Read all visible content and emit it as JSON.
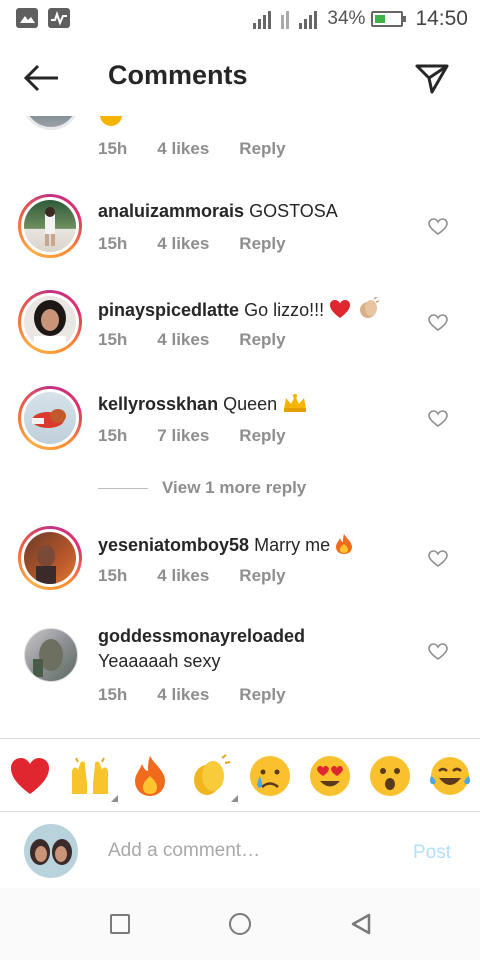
{
  "status_bar": {
    "battery": "34%",
    "time": "14:50"
  },
  "header": {
    "title": "Comments",
    "back_icon": "arrow-left-icon",
    "send_icon": "paper-plane-icon"
  },
  "previous_comment": {
    "time": "15h",
    "likes": "4 likes",
    "reply": "Reply"
  },
  "comments": [
    {
      "username": "analuizammorais",
      "text": "GOSTOSA",
      "time": "15h",
      "likes": "4 likes",
      "reply": "Reply"
    },
    {
      "username": "pinayspicedlatte",
      "text": "Go lizzo!!!",
      "time": "15h",
      "likes": "4 likes",
      "reply": "Reply"
    },
    {
      "username": "kellyrosskhan",
      "text": "Queen",
      "time": "15h",
      "likes": "7 likes",
      "reply": "Reply"
    },
    {
      "username": "yeseniatomboy58",
      "text": "Marry me",
      "time": "15h",
      "likes": "4 likes",
      "reply": "Reply"
    },
    {
      "username": "goddessmonayreloaded",
      "text": "Yeaaaaah sexy",
      "time": "15h",
      "likes": "4 likes",
      "reply": "Reply"
    }
  ],
  "view_more_replies": "View 1 more reply",
  "emoji_bar": [
    "red-heart",
    "raising-hands",
    "fire",
    "clapping-hands",
    "crying-face",
    "heart-eyes-face",
    "astonished-face",
    "tears-of-joy-face"
  ],
  "composer": {
    "placeholder": "Add a comment…",
    "post_label": "Post"
  },
  "colors": {
    "post_inactive": "#b2dffc",
    "meta_gray": "#8e8e8e",
    "story_ring_start": "#c13584",
    "story_ring_end": "#fcaf45"
  }
}
